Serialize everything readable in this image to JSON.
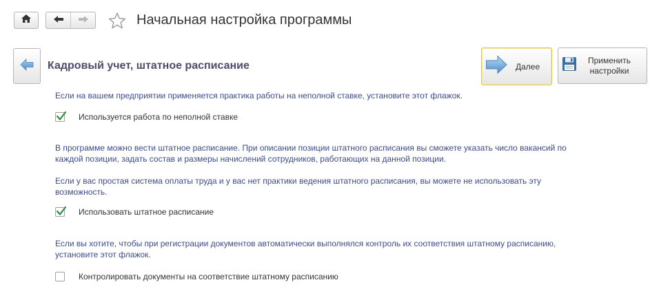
{
  "window": {
    "title": "Начальная настройка программы"
  },
  "toolbar": {
    "home_icon": "home-icon",
    "back_icon": "arrow-left-icon",
    "forward_icon": "arrow-right-icon",
    "favorite_icon": "star-icon"
  },
  "wizard": {
    "section_title": "Кадровый учет, штатное расписание",
    "next_label": "Далее",
    "apply_label": "Применить настройки",
    "next_icon": "arrow-right-icon",
    "apply_icon": "floppy-disk-icon",
    "back_icon": "arrow-left-icon"
  },
  "content": {
    "part_time_hint": "Если на вашем предприятии применяется практика работы на неполной ставке, установите этот флажок.",
    "part_time_checkbox": {
      "label": "Используется работа по неполной ставке",
      "checked": true
    },
    "staffing_hint_1": "В программе можно вести штатное расписание. При описании позиции штатного расписания вы сможете указать число вакансий по каждой позиции, задать состав и размеры начислений сотрудников, работающих на данной позиции.",
    "staffing_hint_2": "Если у вас простая система оплаты труда и у вас нет практики ведения штатного расписания, вы можете не использовать эту возможность.",
    "staffing_checkbox": {
      "label": "Использовать штатное расписание",
      "checked": true
    },
    "control_hint": "Если вы хотите, чтобы при регистрации документов автоматически выполнялся контроль их соответствия штатному расписанию, установите этот флажок.",
    "control_checkbox": {
      "label": "Контролировать документы на соответствие штатному расписанию",
      "checked": false
    }
  },
  "colors": {
    "hint_text": "#3c4a8c",
    "section_title": "#4b4b6b",
    "check_mark": "#2e8b3a",
    "arrow_blue": "#6aa6d8",
    "default_button_border": "#d8c65a"
  }
}
